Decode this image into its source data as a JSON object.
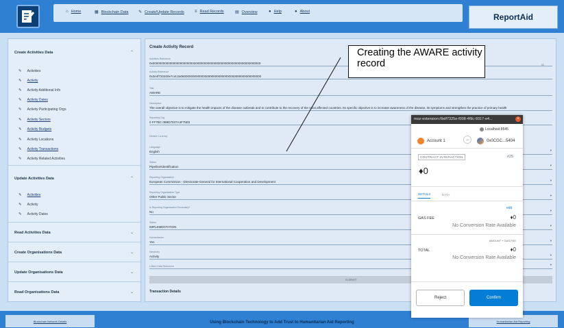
{
  "header": {
    "nav": [
      {
        "label": "Home",
        "icon": "home-icon",
        "glyph": "⌂"
      },
      {
        "label": "Blockchain Data",
        "icon": "grid-icon",
        "glyph": "▦"
      },
      {
        "label": "Create/Update Records",
        "icon": "pencil-icon",
        "glyph": "✎"
      },
      {
        "label": "Read Records",
        "icon": "list-icon",
        "glyph": "≡"
      },
      {
        "label": "Overview",
        "icon": "chart-icon",
        "glyph": "▤"
      },
      {
        "label": "Help",
        "icon": "help-icon",
        "glyph": "●"
      },
      {
        "label": "About",
        "icon": "info-icon",
        "glyph": "●"
      }
    ],
    "brand": "ReportAid"
  },
  "sidebar": {
    "create": {
      "title": "Create Activities Data",
      "items": [
        {
          "label": "Activities",
          "link": false
        },
        {
          "label": "Activity",
          "link": true
        },
        {
          "label": "Activity Additional Info",
          "link": false
        },
        {
          "label": "Activity Dates",
          "link": true
        },
        {
          "label": "Activity Participating Orgs",
          "link": false
        },
        {
          "label": "Activity Sectors",
          "link": true
        },
        {
          "label": "Activity Budgets",
          "link": true
        },
        {
          "label": "Activity Locations",
          "link": false
        },
        {
          "label": "Activity Transactions",
          "link": true
        },
        {
          "label": "Activity Related Activities",
          "link": false
        }
      ]
    },
    "update": {
      "title": "Update Activities Data",
      "items": [
        {
          "label": "Activities",
          "link": true
        },
        {
          "label": "Activity",
          "link": false
        },
        {
          "label": "Activity Dates",
          "link": false
        }
      ]
    },
    "others": [
      "Read Activities Data",
      "Create Organisations Data",
      "Update Organisations Data",
      "Read Organisations Data"
    ]
  },
  "form": {
    "title": "Create Activity Record",
    "right_label": "ID",
    "fields": [
      {
        "label": "Activities Reference",
        "value": "0x000000000000000000000000000000000000000000000000000000000000000"
      },
      {
        "label": "Activity Reference",
        "value": "0x3e4f720400e7c4c2a06000000000000000000000000000000000000000000000"
      },
      {
        "label": "Title",
        "value": "AWARE"
      },
      {
        "label": "Description",
        "value": "The overall objective is to mitigate the health impacts of the disease outbreak and to contribute to the recovery of the most affected countries. Its specific objective is to increase awareness of the disease, its symptoms and strengthen the practice of primary health"
      },
      {
        "label": "Reporting Org",
        "value": "0 FF7BC 0B9D7037A4F75E5"
      },
      {
        "label": "Default Currency",
        "value": ""
      },
      {
        "label": "Language",
        "value": "English"
      },
      {
        "label": "Status",
        "value": "Pipeline/Identification"
      },
      {
        "label": "Reporting Organisation",
        "value": "European Commission - Directorate-General for International Cooperation and Development"
      },
      {
        "label": "Reporting Organisation Type",
        "value": "Other Public Sector"
      },
      {
        "label": "Is Reporting Organisation Secondary?",
        "value": "No"
      },
      {
        "label": "Status",
        "value": "IMPLEMENTATION"
      },
      {
        "label": "Humanitarian",
        "value": "Yes"
      },
      {
        "label": "Hierarchy",
        "value": "Activity"
      },
      {
        "label": "Linked Data Reference",
        "value": ""
      }
    ],
    "submit": "SUBMIT",
    "transaction_title": "Transaction Details"
  },
  "footer": {
    "left_button": "Blockchain Network Details",
    "text": "Using Blockchain Technology to Add Trust to Humanitarian Aid Reporting",
    "right_button": "Humanitarian Aid Reporting"
  },
  "annotation": "Creating the AWARE activity record",
  "metamask": {
    "titlebar": "moz-extension://bdf7325e-f008-4f9c-9317-e4...",
    "network": "Localhost 8545",
    "from": "Account 1",
    "to": "0x0CGC...5404",
    "badge": "CONTRACT INTERACTION",
    "tx_id": "#25",
    "amount": "0",
    "tab_details": "DETAILS",
    "tab_data": "DATA",
    "edit": "edit",
    "gas_label": "GAS FEE",
    "gas_value": "0",
    "no_rate": "No Conversion Rate Available",
    "amount_gas_label": "AMOUNT + GAS FEE",
    "total_label": "TOTAL",
    "total_value": "0",
    "reject": "Reject",
    "confirm": "Confirm"
  }
}
